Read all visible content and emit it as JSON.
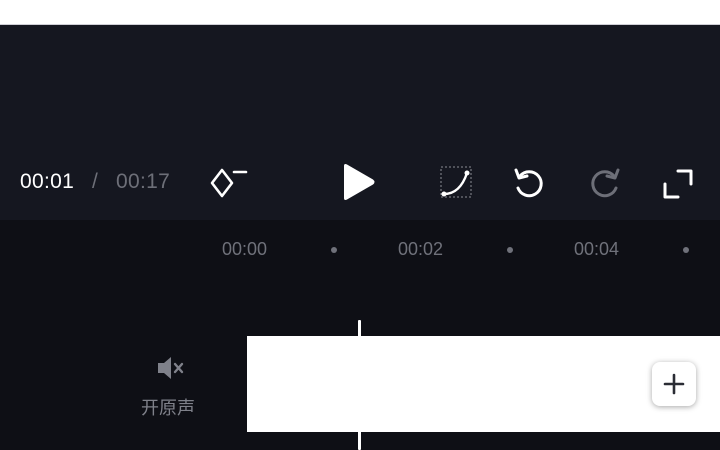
{
  "playback": {
    "current_time": "00:01",
    "separator": "/",
    "total_time": "00:17"
  },
  "controls": {
    "keyframe_icon": "keyframe-remove-icon",
    "play_icon": "play-icon",
    "curve_icon": "speed-curve-icon",
    "undo_icon": "undo-icon",
    "redo_icon": "redo-icon",
    "redo_enabled": false,
    "fullscreen_icon": "fullscreen-icon"
  },
  "timeline": {
    "ruler": [
      "00:00",
      "00:02",
      "00:04"
    ],
    "mute_label": "开原声",
    "mute_icon": "speaker-muted-icon",
    "add_clip_icon": "plus-icon"
  },
  "colors": {
    "background": "#0f1017",
    "panel": "#151720",
    "text_primary": "#ffffff",
    "text_muted": "#6d6f78"
  }
}
